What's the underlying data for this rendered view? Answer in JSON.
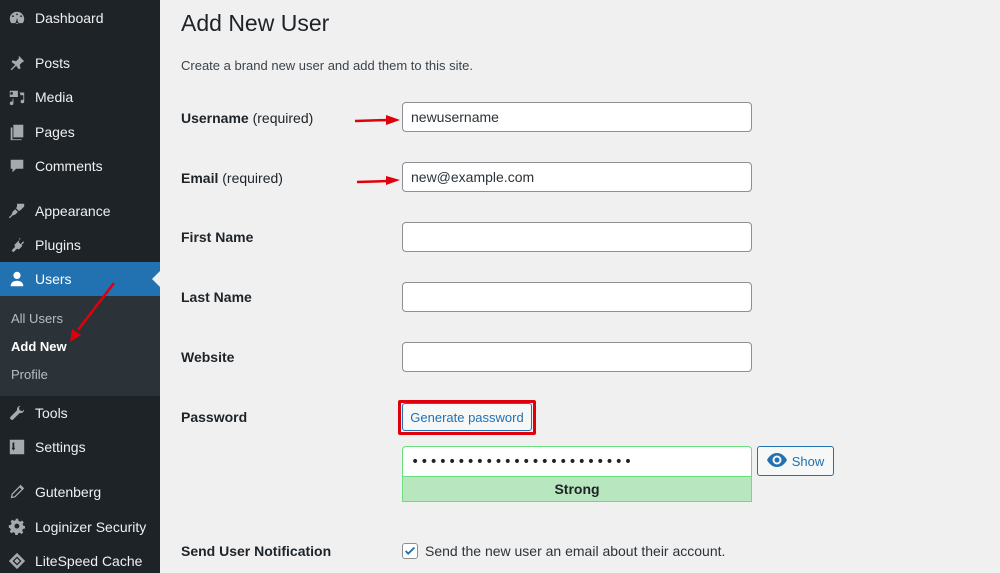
{
  "sidebar": {
    "items": [
      {
        "label": "Dashboard",
        "icon": "dashboard-icon"
      },
      {
        "label": "Posts",
        "icon": "pin-icon"
      },
      {
        "label": "Media",
        "icon": "media-icon"
      },
      {
        "label": "Pages",
        "icon": "pages-icon"
      },
      {
        "label": "Comments",
        "icon": "comment-icon"
      },
      {
        "label": "Appearance",
        "icon": "paintbrush-icon"
      },
      {
        "label": "Plugins",
        "icon": "plugin-icon"
      },
      {
        "label": "Users",
        "icon": "user-icon",
        "active": true
      },
      {
        "label": "Tools",
        "icon": "wrench-icon"
      },
      {
        "label": "Settings",
        "icon": "settings-icon"
      },
      {
        "label": "Gutenberg",
        "icon": "pencil-icon"
      },
      {
        "label": "Loginizer Security",
        "icon": "gear-icon"
      },
      {
        "label": "LiteSpeed Cache",
        "icon": "diamond-icon"
      }
    ],
    "submenu": [
      {
        "label": "All Users"
      },
      {
        "label": "Add New",
        "current": true
      },
      {
        "label": "Profile"
      }
    ]
  },
  "page": {
    "title": "Add New User",
    "description": "Create a brand new user and add them to this site."
  },
  "form": {
    "username": {
      "label": "Username",
      "required": "(required)",
      "value": "newusername"
    },
    "email": {
      "label": "Email",
      "required": "(required)",
      "value": "new@example.com"
    },
    "first_name": {
      "label": "First Name",
      "value": ""
    },
    "last_name": {
      "label": "Last Name",
      "value": ""
    },
    "website": {
      "label": "Website",
      "value": ""
    },
    "password": {
      "label": "Password",
      "generate_label": "Generate password",
      "masked_value": "••••••••••••••••••••••••",
      "strength": "Strong",
      "show_label": "Show"
    },
    "notification": {
      "label": "Send User Notification",
      "checkbox_label": "Send the new user an email about their account.",
      "checked": true
    }
  },
  "colors": {
    "sidebar_bg": "#1d2327",
    "accent": "#2271b1",
    "strength_bg": "#b8e6bf",
    "annotation": "#e0000b"
  }
}
